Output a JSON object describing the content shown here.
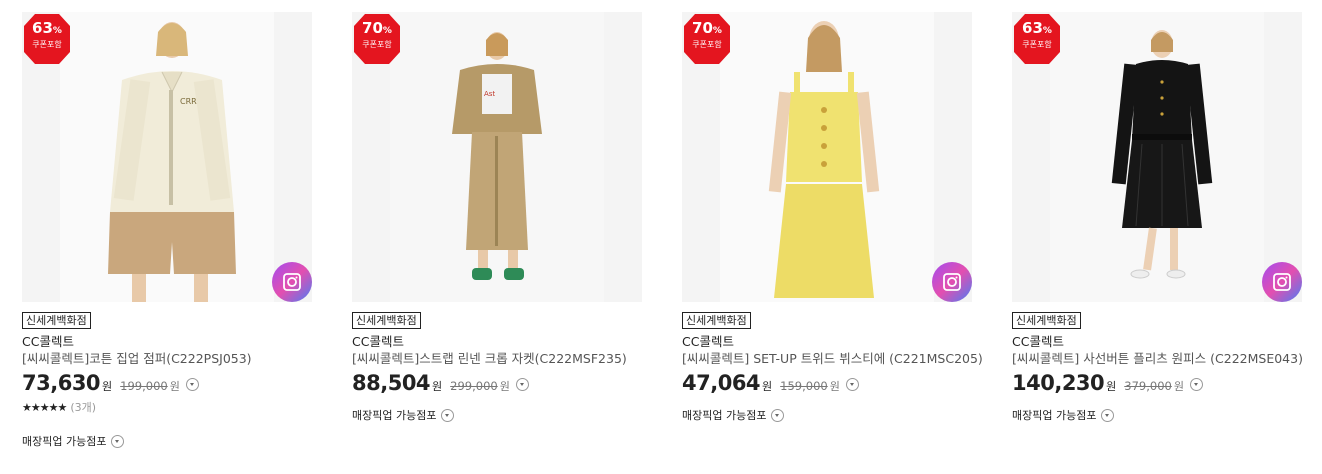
{
  "products": [
    {
      "discount": "63",
      "discount_unit": "%",
      "coupon": "쿠폰포함",
      "store": "신세계백화점",
      "brand": "CC콜렉트",
      "name": "[씨씨콜렉트]코튼 집업 점퍼(C222PSJ053)",
      "price": "73,630",
      "won": "원",
      "original": "199,000",
      "stars": "★★★★★",
      "review_count": "(3개)",
      "pickup": "매장픽업 가능점포",
      "image_icon": "jacket-shorts-model-photo"
    },
    {
      "discount": "70",
      "discount_unit": "%",
      "coupon": "쿠폰포함",
      "store": "신세계백화점",
      "brand": "CC콜렉트",
      "name": "[씨씨콜렉트]스트랩 린넨 크롭 자켓(C222MSF235)",
      "price": "88,504",
      "won": "원",
      "original": "299,000",
      "pickup": "매장픽업 가능점포",
      "image_icon": "crop-jacket-skirt-model-photo"
    },
    {
      "discount": "70",
      "discount_unit": "%",
      "coupon": "쿠폰포함",
      "store": "신세계백화점",
      "brand": "CC콜렉트",
      "name": "[씨씨콜렉트] SET-UP 트위드 뷔스티에 (C221MSC205)",
      "price": "47,064",
      "won": "원",
      "original": "159,000",
      "pickup": "매장픽업 가능점포",
      "image_icon": "yellow-tweed-setup-model-photo"
    },
    {
      "discount": "63",
      "discount_unit": "%",
      "coupon": "쿠폰포함",
      "store": "신세계백화점",
      "brand": "CC콜렉트",
      "name": "[씨씨콜렉트] 사선버튼 플리츠 원피스 (C222MSE043)",
      "price": "140,230",
      "won": "원",
      "original": "379,000",
      "pickup": "매장픽업 가능점포",
      "image_icon": "black-pleats-dress-model-photo"
    }
  ],
  "colors": {
    "badge_red": "#e4151f",
    "text": "#222222",
    "muted": "#777777"
  }
}
